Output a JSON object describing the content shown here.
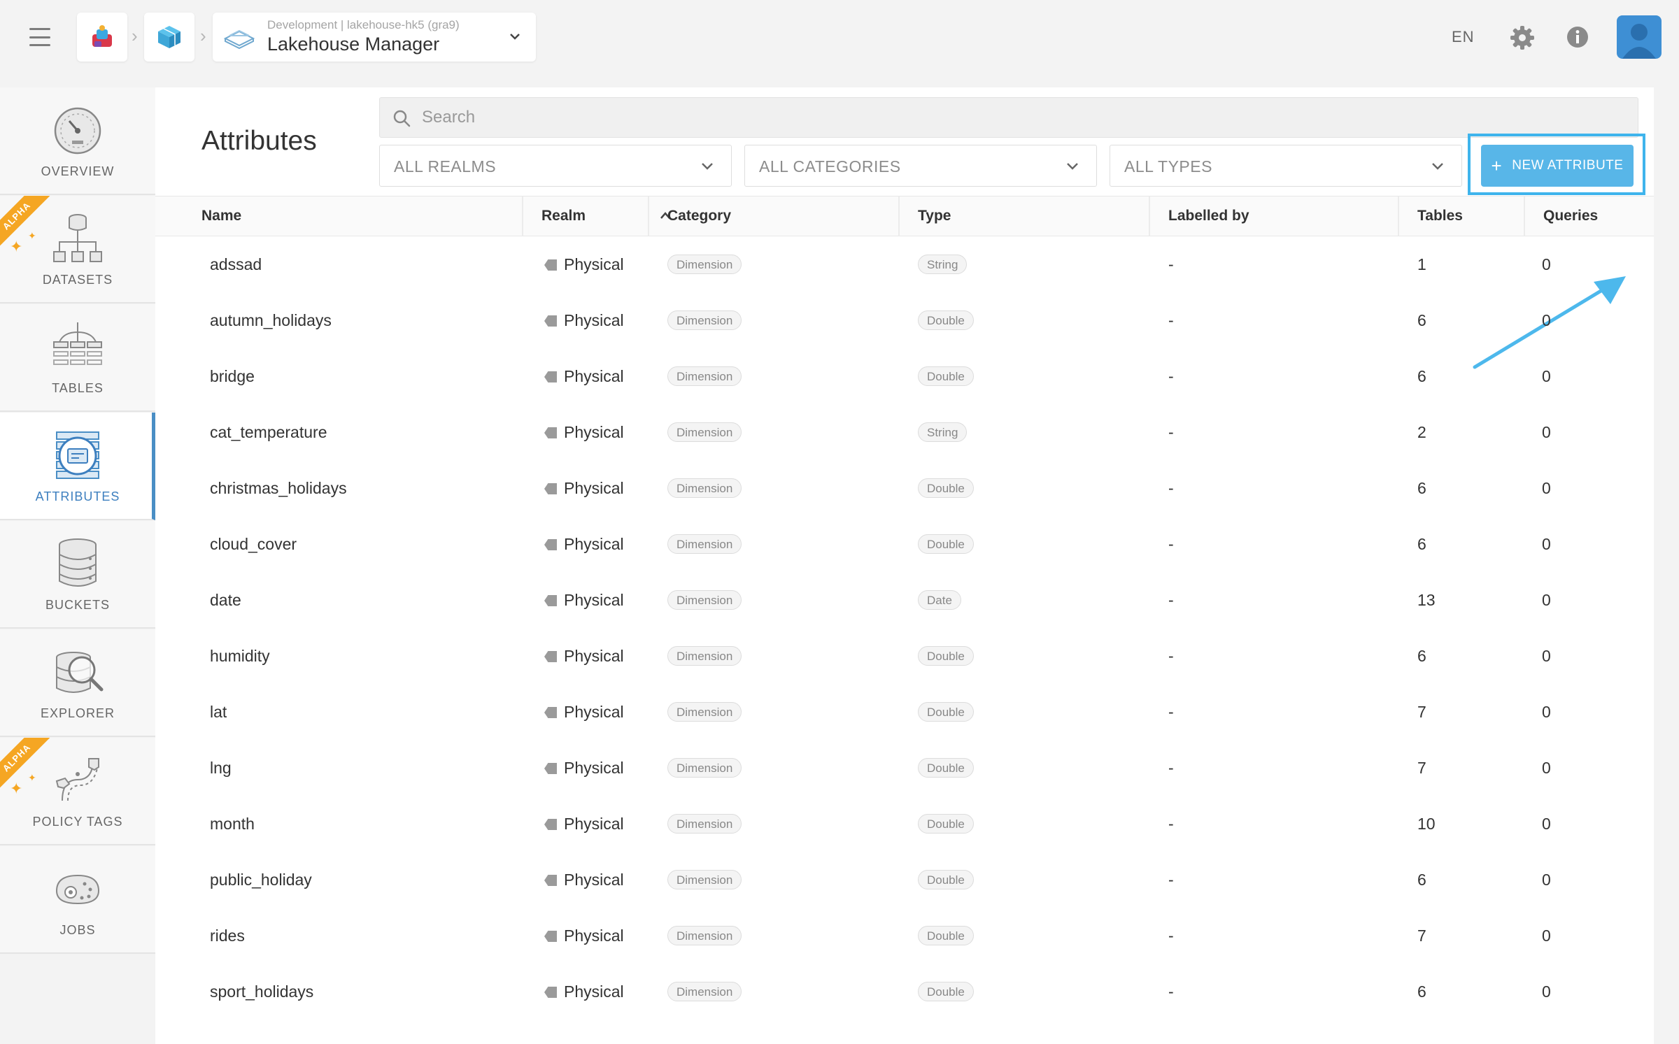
{
  "header": {
    "breadcrumb_sub": "Development | lakehouse-hk5 (gra9)",
    "breadcrumb_title": "Lakehouse Manager",
    "lang": "EN"
  },
  "sidebar": {
    "alpha_label": "ALPHA",
    "items": [
      {
        "label": "OVERVIEW",
        "icon": "gauge-icon"
      },
      {
        "label": "DATASETS",
        "icon": "hierarchy-icon",
        "alpha": true
      },
      {
        "label": "TABLES",
        "icon": "tables-icon"
      },
      {
        "label": "ATTRIBUTES",
        "icon": "attributes-icon",
        "active": true
      },
      {
        "label": "BUCKETS",
        "icon": "database-icon"
      },
      {
        "label": "EXPLORER",
        "icon": "magnifier-database-icon"
      },
      {
        "label": "POLICY TAGS",
        "icon": "policy-tags-icon",
        "alpha": true
      },
      {
        "label": "JOBS",
        "icon": "jobs-icon"
      }
    ]
  },
  "main": {
    "title": "Attributes",
    "search_placeholder": "Search",
    "filters": [
      "ALL REALMS",
      "ALL CATEGORIES",
      "ALL TYPES"
    ],
    "new_button": "NEW ATTRIBUTE"
  },
  "table": {
    "columns": [
      "Name",
      "Realm",
      "Category",
      "Type",
      "Labelled by",
      "Tables",
      "Queries"
    ],
    "rows": [
      {
        "name": "adssad",
        "realm": "Physical",
        "category": "Dimension",
        "type": "String",
        "labelled_by": "-",
        "tables": "1",
        "queries": "0"
      },
      {
        "name": "autumn_holidays",
        "realm": "Physical",
        "category": "Dimension",
        "type": "Double",
        "labelled_by": "-",
        "tables": "6",
        "queries": "0"
      },
      {
        "name": "bridge",
        "realm": "Physical",
        "category": "Dimension",
        "type": "Double",
        "labelled_by": "-",
        "tables": "6",
        "queries": "0"
      },
      {
        "name": "cat_temperature",
        "realm": "Physical",
        "category": "Dimension",
        "type": "String",
        "labelled_by": "-",
        "tables": "2",
        "queries": "0"
      },
      {
        "name": "christmas_holidays",
        "realm": "Physical",
        "category": "Dimension",
        "type": "Double",
        "labelled_by": "-",
        "tables": "6",
        "queries": "0"
      },
      {
        "name": "cloud_cover",
        "realm": "Physical",
        "category": "Dimension",
        "type": "Double",
        "labelled_by": "-",
        "tables": "6",
        "queries": "0"
      },
      {
        "name": "date",
        "realm": "Physical",
        "category": "Dimension",
        "type": "Date",
        "labelled_by": "-",
        "tables": "13",
        "queries": "0"
      },
      {
        "name": "humidity",
        "realm": "Physical",
        "category": "Dimension",
        "type": "Double",
        "labelled_by": "-",
        "tables": "6",
        "queries": "0"
      },
      {
        "name": "lat",
        "realm": "Physical",
        "category": "Dimension",
        "type": "Double",
        "labelled_by": "-",
        "tables": "7",
        "queries": "0"
      },
      {
        "name": "lng",
        "realm": "Physical",
        "category": "Dimension",
        "type": "Double",
        "labelled_by": "-",
        "tables": "7",
        "queries": "0"
      },
      {
        "name": "month",
        "realm": "Physical",
        "category": "Dimension",
        "type": "Double",
        "labelled_by": "-",
        "tables": "10",
        "queries": "0"
      },
      {
        "name": "public_holiday",
        "realm": "Physical",
        "category": "Dimension",
        "type": "Double",
        "labelled_by": "-",
        "tables": "6",
        "queries": "0"
      },
      {
        "name": "rides",
        "realm": "Physical",
        "category": "Dimension",
        "type": "Double",
        "labelled_by": "-",
        "tables": "7",
        "queries": "0"
      },
      {
        "name": "sport_holidays",
        "realm": "Physical",
        "category": "Dimension",
        "type": "Double",
        "labelled_by": "-",
        "tables": "6",
        "queries": "0"
      }
    ]
  },
  "colors": {
    "accent": "#58b6e8",
    "active_nav": "#4a8ec5",
    "alpha_badge": "#f5a623",
    "highlight": "#3fb4ec"
  }
}
